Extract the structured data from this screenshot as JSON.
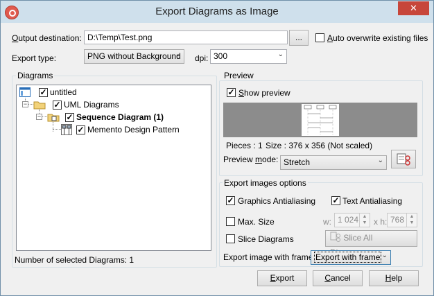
{
  "window": {
    "title": "Export Diagrams as Image",
    "close_glyph": "✕"
  },
  "output": {
    "label_u": "O",
    "label_rest": "utput destination:",
    "value": "D:\\Temp\\Test.png",
    "browse_label": "...",
    "auto_overwrite_u": "A",
    "auto_overwrite_rest": "uto overwrite existing files",
    "auto_overwrite_checked": false
  },
  "export_type": {
    "label": "Export type:",
    "value": "PNG without Background",
    "dpi_label": "dpi:",
    "dpi_value": "300"
  },
  "diagrams": {
    "title": "Diagrams",
    "tree": [
      {
        "label": "untitled",
        "checked": true,
        "icon": "project-icon"
      },
      {
        "label": "UML Diagrams",
        "checked": true,
        "icon": "folder-icon"
      },
      {
        "label": "Sequence Diagram (1)",
        "checked": true,
        "icon": "sequence-folder-icon"
      },
      {
        "label": "Memento Design Pattern",
        "checked": true,
        "icon": "sequence-diagram-icon"
      }
    ],
    "count_label": "Number of selected Diagrams: 1"
  },
  "preview": {
    "title": "Preview",
    "show_u": "S",
    "show_rest": "how preview",
    "show_checked": true,
    "pieces": "Pieces : 1",
    "size": "Size : 376 x 356 (Not scaled)",
    "mode_label": "Preview ",
    "mode_u": "m",
    "mode_rest": "ode:",
    "mode_value": "Stretch"
  },
  "options": {
    "title": "Export images options",
    "graphics_label": "Graphics Antialiasing",
    "graphics_checked": true,
    "text_label": "Text Antialiasing",
    "text_checked": true,
    "max_size_label": "Max. Size",
    "max_size_checked": false,
    "w_label": "w:",
    "w_value": "1 024",
    "h_label": "x h:",
    "h_value": "768",
    "slice_label": "Slice Diagrams",
    "slice_checked": false,
    "slice_all_label": "Slice All Diagrams...",
    "frame_label": "Export image with frame :",
    "frame_value": "Export with frame"
  },
  "buttons": {
    "export": "Export",
    "cancel": "Cancel",
    "help": "Help"
  }
}
